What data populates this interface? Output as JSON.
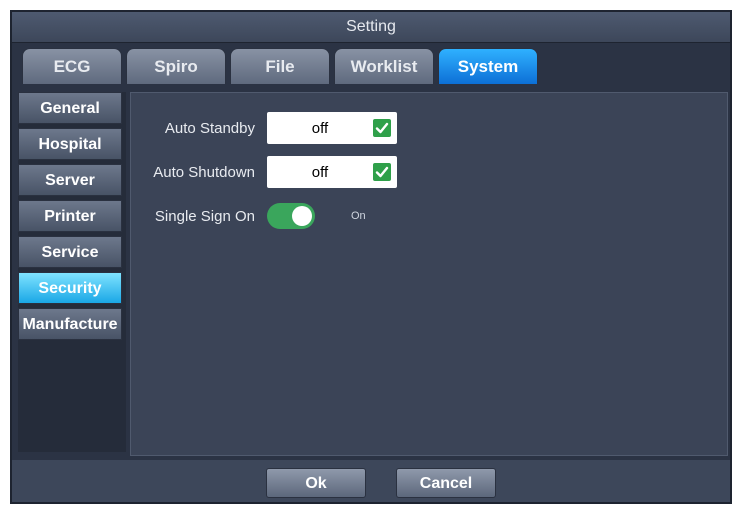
{
  "window": {
    "title": "Setting"
  },
  "tabs": [
    {
      "label": "ECG"
    },
    {
      "label": "Spiro"
    },
    {
      "label": "File"
    },
    {
      "label": "Worklist"
    },
    {
      "label": "System",
      "active": true
    }
  ],
  "sidebar": {
    "items": [
      {
        "label": "General"
      },
      {
        "label": "Hospital"
      },
      {
        "label": "Server"
      },
      {
        "label": "Printer"
      },
      {
        "label": "Service"
      },
      {
        "label": "Security",
        "active": true
      },
      {
        "label": "Manufacture"
      }
    ]
  },
  "settings": {
    "auto_standby": {
      "label": "Auto Standby",
      "value": "off",
      "checked": true
    },
    "auto_shutdown": {
      "label": "Auto Shutdown",
      "value": "off",
      "checked": true
    },
    "single_sign_on": {
      "label": "Single Sign On",
      "state": "On",
      "enabled": true
    }
  },
  "footer": {
    "ok_label": "Ok",
    "cancel_label": "Cancel"
  },
  "colors": {
    "accent": "#1aa7e6",
    "active_tab": "#0d6fd6",
    "check_green": "#2fa04a",
    "toggle_green": "#3aa65c"
  },
  "icons": {
    "check": "checkmark-icon"
  }
}
